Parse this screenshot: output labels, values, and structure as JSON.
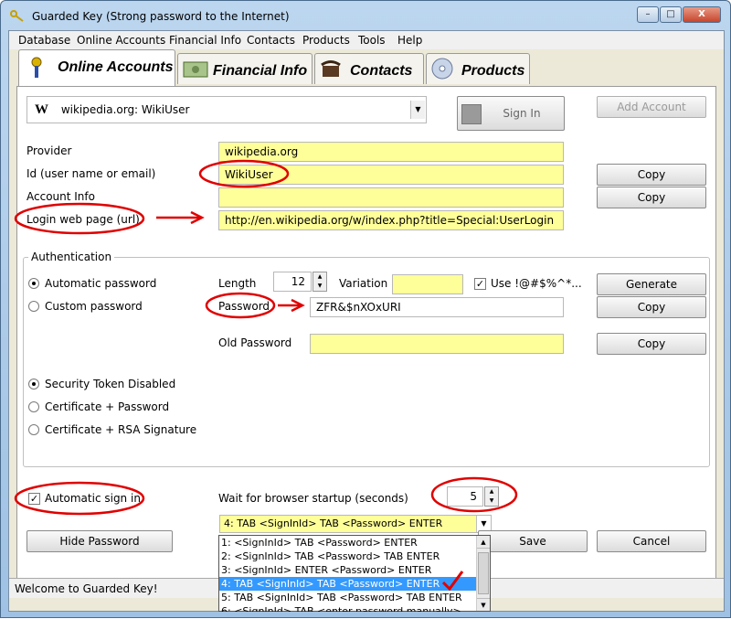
{
  "window": {
    "title": "Guarded Key (Strong password to the Internet)",
    "min_glyph": "–",
    "max_glyph": "□",
    "close_glyph": "X"
  },
  "menu": [
    "Database",
    "Online Accounts",
    "Financial Info",
    "Contacts",
    "Products",
    "Tools",
    "Help"
  ],
  "tabs": [
    {
      "label": "Online Accounts",
      "icon": "key-ribbon-icon",
      "active": true
    },
    {
      "label": "Financial Info",
      "icon": "money-icon",
      "active": false
    },
    {
      "label": "Contacts",
      "icon": "telephone-icon",
      "active": false
    },
    {
      "label": "Products",
      "icon": "cd-icon",
      "active": false
    }
  ],
  "account_select": {
    "icon_letter": "W",
    "value": "wikipedia.org: WikiUser"
  },
  "buttons": {
    "sign_in": "Sign In",
    "add_account": "Add Account",
    "copy": "Copy",
    "generate": "Generate",
    "hide_password": "Hide Password",
    "save": "Save",
    "cancel": "Cancel"
  },
  "fields": {
    "provider_label": "Provider",
    "provider_value": "wikipedia.org",
    "id_label": "Id (user name or email)",
    "id_value": "WikiUser",
    "account_info_label": "Account Info",
    "account_info_value": "",
    "login_page_label": "Login web page (url)",
    "login_page_value": "http://en.wikipedia.org/w/index.php?title=Special:UserLogin"
  },
  "authentication": {
    "group_title": "Authentication",
    "automatic_password": "Automatic password",
    "custom_password": "Custom password",
    "length_label": "Length",
    "length_value": "12",
    "variation_label": "Variation",
    "variation_value": "",
    "use_special_label": "Use !@#$%^*...",
    "use_special_checked": true,
    "password_label": "Password",
    "password_value": "ZFR&$nXOxURI",
    "old_password_label": "Old Password",
    "old_password_value": "",
    "security_token_disabled": "Security Token Disabled",
    "certificate_password": "Certificate + Password",
    "certificate_rsa": "Certificate + RSA Signature"
  },
  "signin": {
    "automatic_sign_in_label": "Automatic sign in",
    "automatic_sign_in_checked": true,
    "wait_label": "Wait for browser startup (seconds)",
    "wait_value": "5",
    "sequence_selected": "4: TAB <SignInId> TAB <Password> ENTER",
    "sequence_options": [
      "1: <SignInId> TAB <Password> ENTER",
      "2: <SignInId> TAB <Password> TAB ENTER",
      "3: <SignInId> ENTER <Password> ENTER",
      "4: TAB <SignInId> TAB <Password> ENTER",
      "5: TAB <SignInId> TAB <Password> TAB ENTER",
      "6: <SignInId> TAB <enter password manually>"
    ]
  },
  "status": {
    "text": "Welcome to Guarded Key!"
  },
  "colors": {
    "field_yellow": "#ffff99",
    "annotation_red": "#e00000",
    "selection_blue": "#3399ff"
  }
}
